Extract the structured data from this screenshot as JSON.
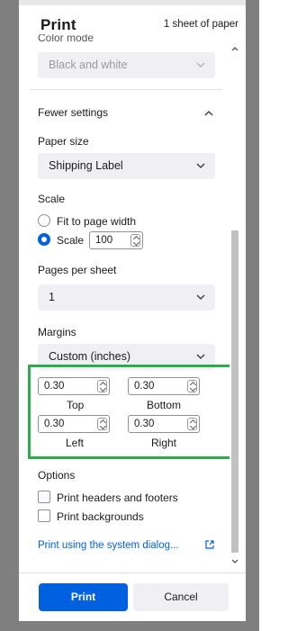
{
  "header": {
    "title": "Print",
    "sheet_count": "1 sheet of paper"
  },
  "color_mode": {
    "label": "Color mode",
    "value": "Black and white"
  },
  "settings_toggle": {
    "label": "Fewer settings"
  },
  "paper_size": {
    "label": "Paper size",
    "value": "Shipping Label"
  },
  "scale": {
    "label": "Scale",
    "fit_label": "Fit to page width",
    "scale_label": "Scale",
    "scale_value": "100",
    "selected": "scale"
  },
  "pages_per_sheet": {
    "label": "Pages per sheet",
    "value": "1"
  },
  "margins": {
    "label": "Margins",
    "value": "Custom (inches)",
    "top": {
      "label": "Top",
      "value": "0.30"
    },
    "bottom": {
      "label": "Bottom",
      "value": "0.30"
    },
    "left": {
      "label": "Left",
      "value": "0.30"
    },
    "right": {
      "label": "Right",
      "value": "0.30"
    }
  },
  "options": {
    "label": "Options",
    "headers_footers": "Print headers and footers",
    "backgrounds": "Print backgrounds"
  },
  "system_dialog_link": "Print using the system dialog...",
  "buttons": {
    "print": "Print",
    "cancel": "Cancel"
  },
  "colors": {
    "accent": "#0061e0",
    "highlight": "#2eaa4f"
  },
  "icons": {
    "chevron": "chevron-down-icon",
    "external": "external-link-icon"
  }
}
